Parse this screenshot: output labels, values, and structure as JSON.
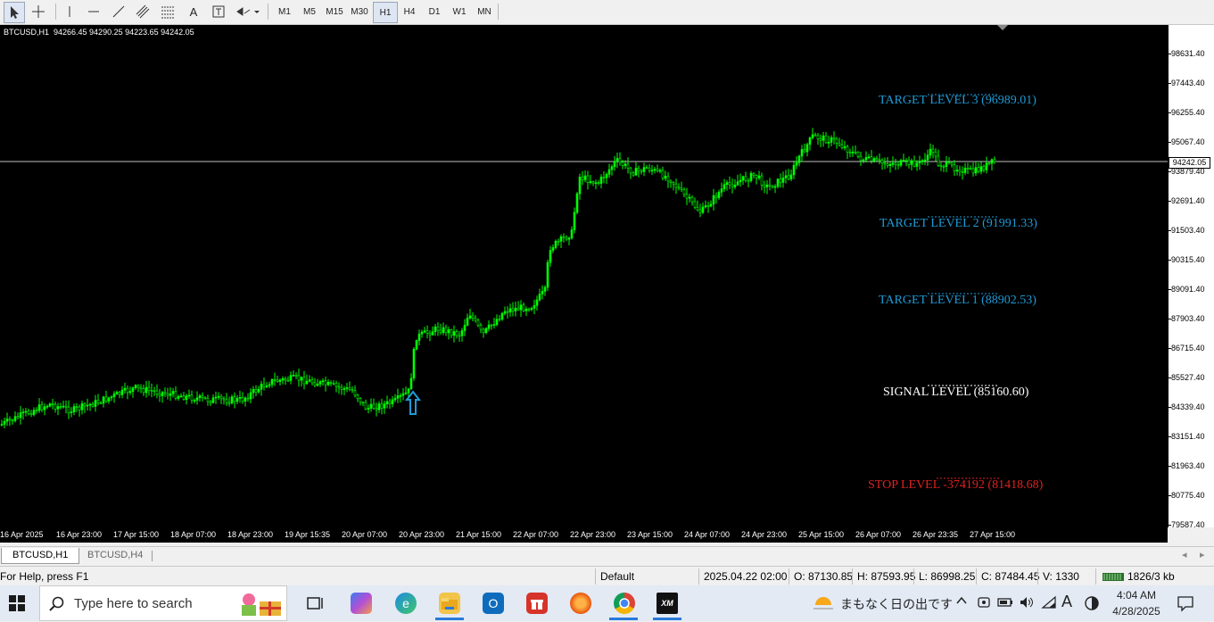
{
  "toolbar": {
    "timeframes": [
      "M1",
      "M5",
      "M15",
      "M30",
      "H1",
      "H4",
      "D1",
      "W1",
      "MN"
    ],
    "selected_timeframe": "H1",
    "text_tool": "A"
  },
  "chart": {
    "info": "BTCUSD,H1  94266.45 94290.25 94223.65 94242.05",
    "current_price": "94242.05",
    "levels": {
      "target3": "TARGET LEVEL 3 (96989.01)",
      "target2": "TARGET LEVEL 2 (91991.33)",
      "target1": "TARGET LEVEL 1 (88902.53)",
      "signal": "SIGNAL LEVEL (85160.60)",
      "stop": "STOP LEVEL -374192 (81418.68)"
    },
    "colors": {
      "bull_candle": "#00ff00",
      "target": "#1e9bd7",
      "signal": "#ffffff",
      "stop": "#e02020",
      "arrow": "#1e9bd7"
    },
    "price_ticks": [
      "98631.40",
      "97443.40",
      "96255.40",
      "95067.40",
      "93879.40",
      "92691.40",
      "91503.40",
      "90315.40",
      "89091.40",
      "87903.40",
      "86715.40",
      "85527.40",
      "84339.40",
      "83151.40",
      "81963.40",
      "80775.40",
      "79587.40"
    ],
    "time_ticks": [
      "16 Apr 2025",
      "16 Apr 23:00",
      "17 Apr 15:00",
      "18 Apr 07:00",
      "18 Apr 23:00",
      "19 Apr 15:35",
      "20 Apr 07:00",
      "20 Apr 23:00",
      "21 Apr 15:00",
      "22 Apr 07:00",
      "22 Apr 23:00",
      "23 Apr 15:00",
      "24 Apr 07:00",
      "24 Apr 23:00",
      "25 Apr 15:00",
      "26 Apr 07:00",
      "26 Apr 23:35",
      "27 Apr 15:00"
    ]
  },
  "tabs": [
    "BTCUSD,H1",
    "BTCUSD,H4"
  ],
  "status": {
    "help": "For Help, press F1",
    "profile": "Default",
    "datetime": "2025.04.22 02:00",
    "open": "O: 87130.85",
    "high": "H: 87593.95",
    "low": "L: 86998.25",
    "close": "C: 87484.45",
    "volume": "V: 1330",
    "traffic": "1826/3 kb"
  },
  "taskbar": {
    "search_placeholder": "Type here to search",
    "weather_text": "まもなく日の出です",
    "time": "4:04 AM",
    "date": "4/28/2025",
    "ime_label": "A"
  }
}
